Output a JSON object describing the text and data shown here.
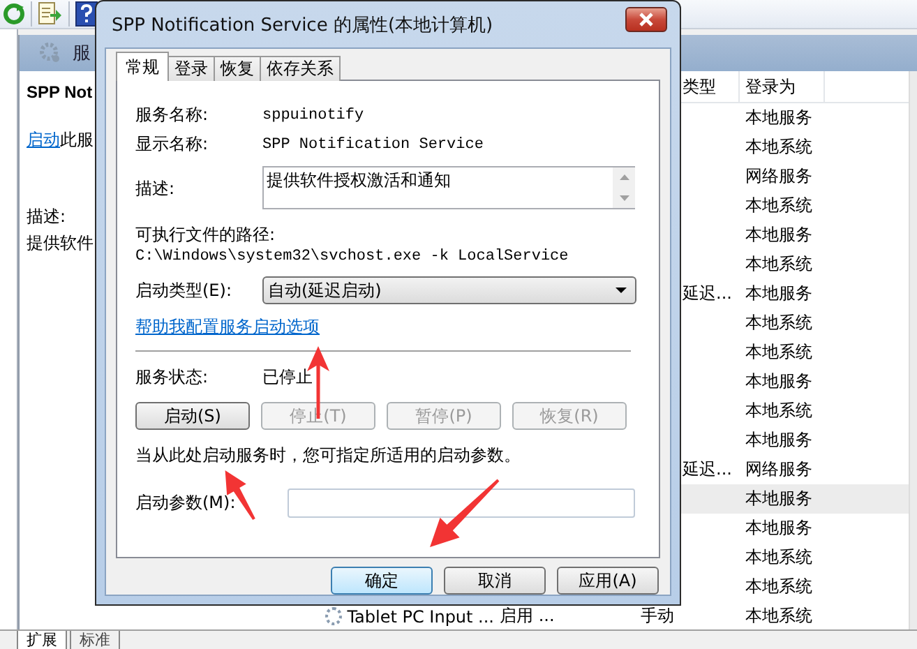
{
  "console": {
    "panel_title": "服",
    "left_pane": {
      "service_name": "SPP Not",
      "action_link": "启动",
      "action_rest": "此服",
      "description_label": "描述:",
      "description": "提供软件"
    },
    "list": {
      "columns": [
        "类型",
        "登录为"
      ],
      "rows": [
        {
          "login": "本地服务",
          "selected": false
        },
        {
          "login": "本地系统",
          "selected": false
        },
        {
          "login": "网络服务",
          "selected": false
        },
        {
          "login": "本地系统",
          "selected": false
        },
        {
          "login": "本地服务",
          "selected": false
        },
        {
          "login": "本地系统",
          "selected": false
        },
        {
          "startup": "延迟...",
          "login": "本地服务",
          "selected": false
        },
        {
          "login": "本地系统",
          "selected": false
        },
        {
          "login": "本地系统",
          "selected": false
        },
        {
          "login": "本地服务",
          "selected": false
        },
        {
          "login": "本地系统",
          "selected": false
        },
        {
          "login": "本地服务",
          "selected": false
        },
        {
          "startup": "延迟...",
          "login": "网络服务",
          "selected": false
        },
        {
          "login": "本地服务",
          "selected": true
        },
        {
          "login": "本地服务",
          "selected": false
        },
        {
          "login": "本地系统",
          "selected": false
        },
        {
          "login": "本地系统",
          "selected": false
        },
        {
          "name": "Tablet PC Input ...",
          "status": "启用 ...",
          "startup": "手动",
          "login": "本地系统",
          "selected": false
        }
      ]
    },
    "view_tabs": [
      {
        "label": "扩展",
        "selected": true
      },
      {
        "label": "标准",
        "selected": false
      }
    ]
  },
  "dialog": {
    "title": "SPP Notification Service 的属性(本地计算机)",
    "tabs": [
      {
        "label": "常规",
        "selected": true
      },
      {
        "label": "登录",
        "selected": false
      },
      {
        "label": "恢复",
        "selected": false
      },
      {
        "label": "依存关系",
        "selected": false
      }
    ],
    "service_name_label": "服务名称:",
    "service_name": "sppuinotify",
    "display_name_label": "显示名称:",
    "display_name": "SPP Notification Service",
    "description_label": "描述:",
    "description": "提供软件授权激活和通知",
    "path_label": "可执行文件的路径:",
    "path": "C:\\Windows\\system32\\svchost.exe -k LocalService",
    "startup_type_label": "启动类型(E):",
    "startup_type": "自动(延迟启动)",
    "help_link": "帮助我配置服务启动选项",
    "status_label": "服务状态:",
    "status_value": "已停止",
    "control_buttons": [
      {
        "label": "启动(S)",
        "disabled": false
      },
      {
        "label": "停止(T)",
        "disabled": true
      },
      {
        "label": "暂停(P)",
        "disabled": true
      },
      {
        "label": "恢复(R)",
        "disabled": true
      }
    ],
    "hint": "当从此处启动服务时，您可指定所适用的启动参数。",
    "params_label": "启动参数(M):",
    "footer_buttons": [
      {
        "label": "确定",
        "default": true
      },
      {
        "label": "取消",
        "default": false
      },
      {
        "label": "应用(A)",
        "default": false
      }
    ]
  }
}
